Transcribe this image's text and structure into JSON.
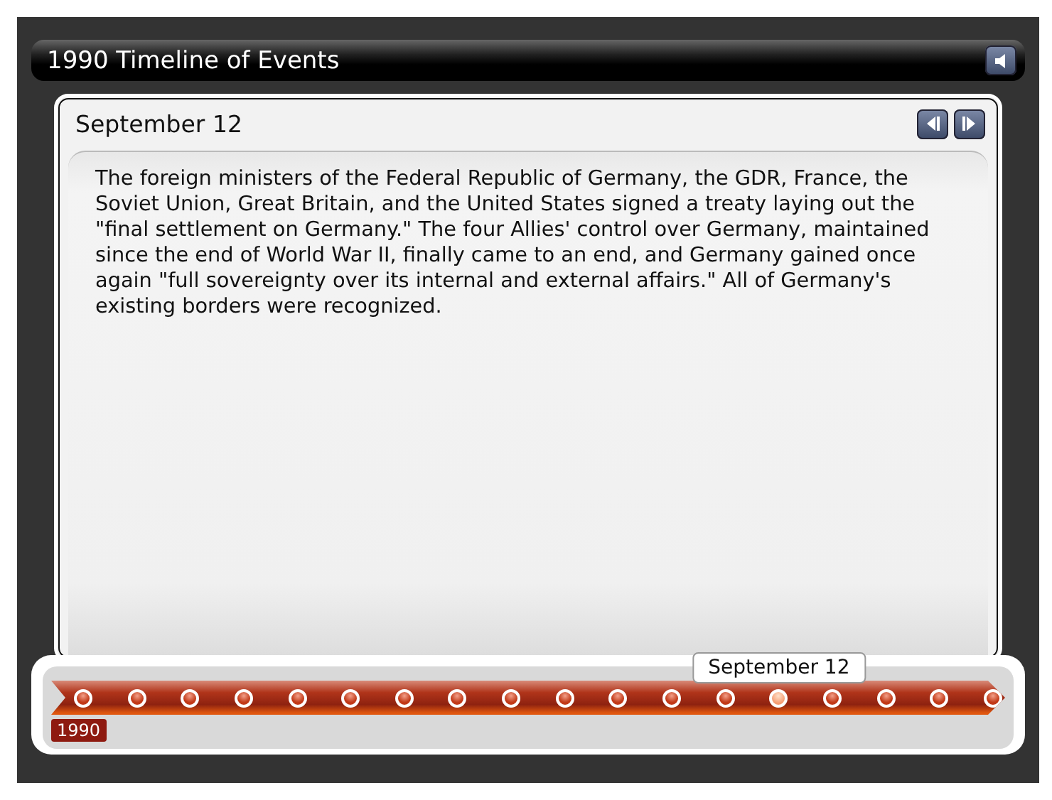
{
  "window": {
    "title": "1990 Timeline of Events"
  },
  "event": {
    "date": "September 12",
    "text": "The foreign ministers of the Federal Republic of Germany, the GDR, France, the Soviet Union, Great Britain, and the United States signed a treaty laying out the \"final settlement on Germany.\" The four Allies' control over Germany, maintained since the end of World War II, finally came to an end, and Germany gained once again \"full sovereignty over its internal and external affairs.\" All of Germany's existing borders were recognized."
  },
  "timeline": {
    "year": "1990",
    "tooltip": "September 12",
    "events": [
      {
        "selected": false
      },
      {
        "selected": false
      },
      {
        "selected": false
      },
      {
        "selected": false
      },
      {
        "selected": false
      },
      {
        "selected": false
      },
      {
        "selected": false
      },
      {
        "selected": false
      },
      {
        "selected": false
      },
      {
        "selected": false
      },
      {
        "selected": false
      },
      {
        "selected": false
      },
      {
        "selected": false
      },
      {
        "selected": true
      },
      {
        "selected": false
      },
      {
        "selected": false
      },
      {
        "selected": false
      },
      {
        "selected": false
      }
    ]
  }
}
